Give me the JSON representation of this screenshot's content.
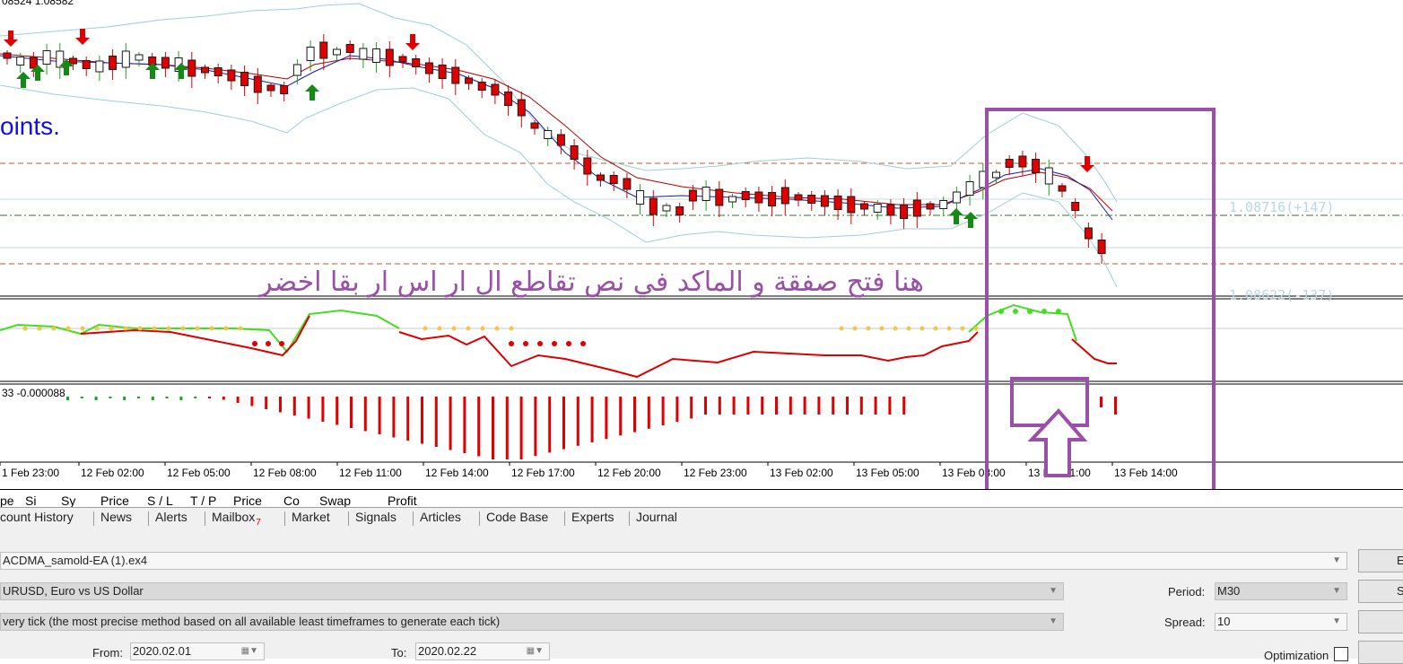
{
  "chart": {
    "top_info": "08524 1.08582",
    "points_text": "oints.",
    "arabic_annotation": "هنا فتح صفقة و الماكد في نص تقاطع ال ار اس ار بقا اخضر",
    "price_label": "1.08716(+147)",
    "price_label_2": "1.08622(-137)",
    "macd_readout": "33 -0.000088",
    "time_labels": [
      "1 Feb 23:00",
      "12 Feb 02:00",
      "12 Feb 05:00",
      "12 Feb 08:00",
      "12 Feb 11:00",
      "12 Feb 14:00",
      "12 Feb 17:00",
      "12 Feb 20:00",
      "12 Feb 23:00",
      "13 Feb 02:00",
      "13 Feb 05:00",
      "13 Feb 08:00",
      "13 Feb 11:00",
      "13 Feb 14:00"
    ],
    "colors": {
      "bull": "#1aa51a",
      "bear": "#e00000",
      "annotation": "#9b4fa8",
      "band": "#9ccfd8",
      "blue_text": "#1010e0"
    }
  },
  "columns": [
    "pe",
    "Si",
    "Sy",
    "Price",
    "S / L",
    "T / P",
    "Price",
    "Co",
    "Swap",
    "Profit"
  ],
  "tabs": [
    {
      "label": "count History"
    },
    {
      "label": "News"
    },
    {
      "label": "Alerts"
    },
    {
      "label": "Mailbox",
      "badge": "7"
    },
    {
      "label": "Market"
    },
    {
      "label": "Signals"
    },
    {
      "label": "Articles"
    },
    {
      "label": "Code Base"
    },
    {
      "label": "Experts"
    },
    {
      "label": "Journal"
    }
  ],
  "tester": {
    "expert": "ACDMA_samold-EA (1).ex4",
    "symbol": "URUSD, Euro vs US Dollar",
    "model": "very tick (the most precise method based on all available least timeframes to generate each tick)",
    "period_label": "Period:",
    "period_value": "M30",
    "spread_label": "Spread:",
    "spread_value": "10",
    "from_label": "From:",
    "from_value": "2020.02.01",
    "to_label": "To:",
    "to_value": "2020.02.22",
    "optimization_label": "Optimization",
    "btn1": "E",
    "btn2": "Sy"
  }
}
